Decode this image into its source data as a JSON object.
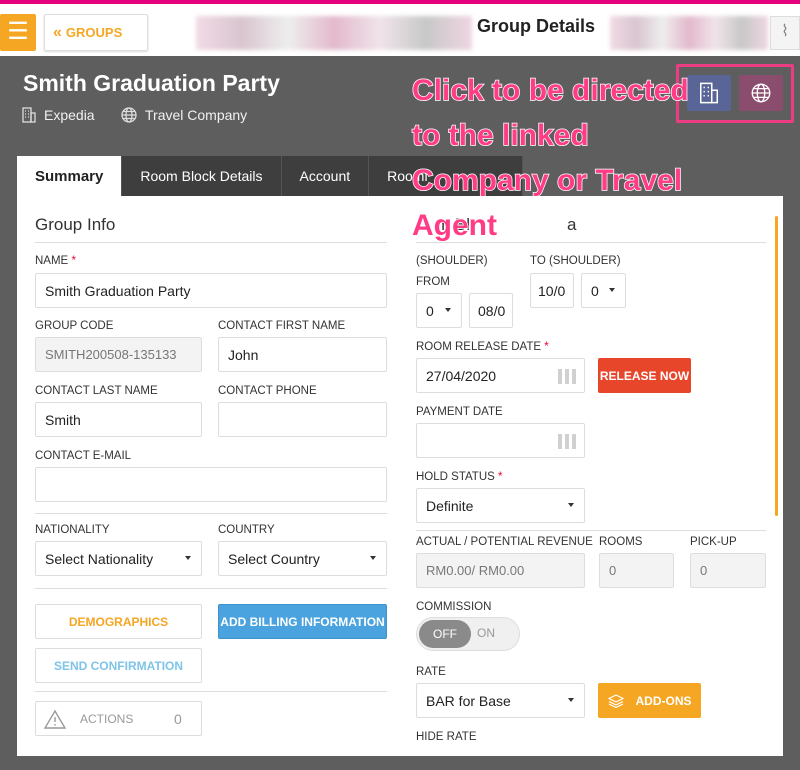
{
  "header": {
    "menu_icon": "hamburger-icon",
    "back_label": "GROUPS",
    "title": "Group Details"
  },
  "group": {
    "name": "Smith Graduation Party",
    "company": "Expedia",
    "travel_agent": "Travel Company"
  },
  "annotation": {
    "text": "Click to be directed to the linked Company or Travel Agent"
  },
  "tabs": [
    "Summary",
    "Room Block Details",
    "Account",
    "Roomi"
  ],
  "group_info": {
    "title": "Group Info",
    "name_label": "NAME",
    "name_value": "Smith Graduation Party",
    "group_code_label": "GROUP CODE",
    "group_code_value": "SMITH200508-135133",
    "contact_first_label": "CONTACT FIRST NAME",
    "contact_first_value": "John",
    "contact_last_label": "CONTACT LAST NAME",
    "contact_last_value": "Smith",
    "contact_phone_label": "CONTACT PHONE",
    "contact_phone_value": "",
    "contact_email_label": "CONTACT E-MAIL",
    "contact_email_value": "",
    "nationality_label": "NATIONALITY",
    "nationality_value": "Select Nationality",
    "country_label": "COUNTRY",
    "country_value": "Select Country",
    "demographics_label": "DEMOGRAPHICS",
    "billing_label": "ADD BILLING INFORMATION",
    "confirmation_label": "SEND CONFIRMATION",
    "actions_label": "ACTIONS",
    "actions_count": "0"
  },
  "right": {
    "title_partial": "m Bl",
    "title_partial2": "a",
    "from_shoulder_label": "(SHOULDER)",
    "from_label": "FROM",
    "to_shoulder_label": "TO (SHOULDER)",
    "from_shoulder_value": "0",
    "from_value": "08/0",
    "to_value": "10/0",
    "to_shoulder_value": "0",
    "release_label": "ROOM RELEASE DATE",
    "release_value": "27/04/2020",
    "release_now": "RELEASE NOW",
    "payment_label": "PAYMENT DATE",
    "payment_value": "",
    "hold_label": "HOLD STATUS",
    "hold_value": "Definite",
    "revenue_label": "ACTUAL / POTENTIAL REVENUE",
    "revenue_value": "RM0.00/ RM0.00",
    "rooms_label": "ROOMS",
    "rooms_value": "0",
    "pickup_label": "PICK-UP",
    "pickup_value": "0",
    "commission_label": "COMMISSION",
    "toggle_off": "OFF",
    "toggle_on": "ON",
    "rate_label": "RATE",
    "rate_value": "BAR for Base",
    "addons_label": "ADD-ONS",
    "hide_rate_label": "HIDE RATE"
  },
  "colors": {
    "accent": "#f5a623",
    "danger": "#e8462b",
    "info": "#4aa3df",
    "company_btn": "#5a6597",
    "agent_btn": "#8b4d6e",
    "annotation": "#ff3d86"
  }
}
